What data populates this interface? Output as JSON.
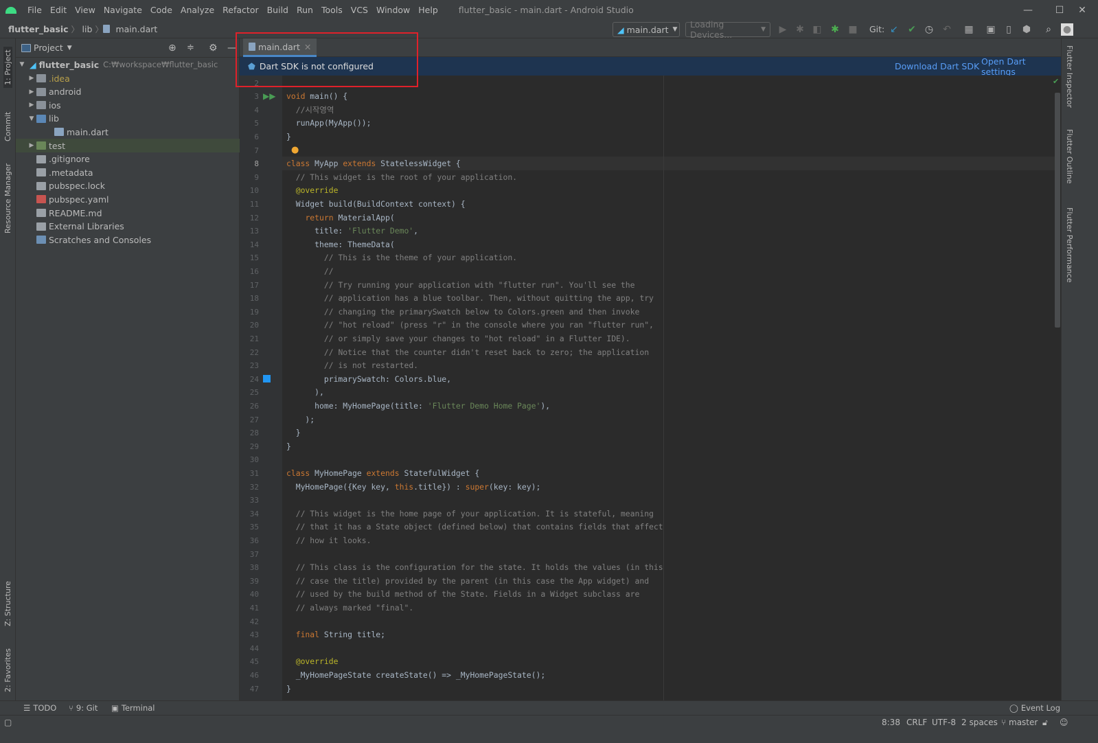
{
  "window": {
    "title": "flutter_basic - main.dart - Android Studio",
    "minimize": "—",
    "maximize": "☐",
    "close": "✕"
  },
  "menu": [
    "File",
    "Edit",
    "View",
    "Navigate",
    "Code",
    "Analyze",
    "Refactor",
    "Build",
    "Run",
    "Tools",
    "VCS",
    "Window",
    "Help"
  ],
  "breadcrumb": [
    "flutter_basic",
    "lib",
    "main.dart"
  ],
  "toolbar": {
    "run_config": "main.dart",
    "device": "Loading Devices...",
    "git_label": "Git:"
  },
  "project_panel": {
    "title": "Project",
    "root": {
      "name": "flutter_basic",
      "path": "C:₩workspace₩flutter_basic"
    },
    "items": [
      {
        "label": ".idea",
        "depth": 1,
        "arrow": "▶",
        "kind": "folder-idea"
      },
      {
        "label": "android",
        "depth": 1,
        "arrow": "▶",
        "kind": "folder"
      },
      {
        "label": "ios",
        "depth": 1,
        "arrow": "▶",
        "kind": "folder"
      },
      {
        "label": "lib",
        "depth": 1,
        "arrow": "▼",
        "kind": "folder-src"
      },
      {
        "label": "main.dart",
        "depth": 2,
        "arrow": "",
        "kind": "dart"
      },
      {
        "label": "test",
        "depth": 1,
        "arrow": "▶",
        "kind": "folder-test",
        "selected": true
      },
      {
        "label": ".gitignore",
        "depth": 1,
        "arrow": "",
        "kind": "file"
      },
      {
        "label": ".metadata",
        "depth": 1,
        "arrow": "",
        "kind": "file"
      },
      {
        "label": "pubspec.lock",
        "depth": 1,
        "arrow": "",
        "kind": "file"
      },
      {
        "label": "pubspec.yaml",
        "depth": 1,
        "arrow": "",
        "kind": "yaml"
      },
      {
        "label": "README.md",
        "depth": 1,
        "arrow": "",
        "kind": "file"
      },
      {
        "label": "External Libraries",
        "depth": 0,
        "arrow": "",
        "kind": "libs"
      },
      {
        "label": "Scratches and Consoles",
        "depth": 0,
        "arrow": "",
        "kind": "scratch"
      }
    ]
  },
  "left_stripe": [
    "1: Project",
    "Commit",
    "Resource Manager",
    "Z: Structure",
    "2: Favorites"
  ],
  "right_stripe": [
    "Flutter Inspector",
    "Flutter Outline",
    "Flutter Performance"
  ],
  "editor": {
    "tab": "main.dart",
    "banner": {
      "message": "Dart SDK is not configured",
      "download": "Download Dart SDK",
      "settings": "Open Dart settings"
    },
    "first_line": 2,
    "lines": [
      [],
      [
        [
          "k",
          "void"
        ],
        [
          "t",
          " main() {"
        ]
      ],
      [
        [
          "t",
          "  "
        ],
        [
          "c",
          "//시작영역"
        ]
      ],
      [
        [
          "t",
          "  runApp(MyApp());"
        ]
      ],
      [
        [
          "t",
          "}"
        ]
      ],
      [],
      [
        [
          "k",
          "class"
        ],
        [
          "t",
          " MyApp "
        ],
        [
          "k",
          "extends"
        ],
        [
          "t",
          " StatelessWidget {"
        ]
      ],
      [
        [
          "t",
          "  "
        ],
        [
          "c",
          "// This widget is the root of your application."
        ]
      ],
      [
        [
          "t",
          "  "
        ],
        [
          "a",
          "@override"
        ]
      ],
      [
        [
          "t",
          "  Widget build(BuildContext context) {"
        ]
      ],
      [
        [
          "t",
          "    "
        ],
        [
          "k",
          "return"
        ],
        [
          "t",
          " MaterialApp("
        ]
      ],
      [
        [
          "t",
          "      title: "
        ],
        [
          "s",
          "'Flutter Demo'"
        ],
        [
          "t",
          ","
        ]
      ],
      [
        [
          "t",
          "      theme: ThemeData("
        ]
      ],
      [
        [
          "t",
          "        "
        ],
        [
          "c",
          "// This is the theme of your application."
        ]
      ],
      [
        [
          "t",
          "        "
        ],
        [
          "c",
          "//"
        ]
      ],
      [
        [
          "t",
          "        "
        ],
        [
          "c",
          "// Try running your application with \"flutter run\". You'll see the"
        ]
      ],
      [
        [
          "t",
          "        "
        ],
        [
          "c",
          "// application has a blue toolbar. Then, without quitting the app, try"
        ]
      ],
      [
        [
          "t",
          "        "
        ],
        [
          "c",
          "// changing the primarySwatch below to Colors.green and then invoke"
        ]
      ],
      [
        [
          "t",
          "        "
        ],
        [
          "c",
          "// \"hot reload\" (press \"r\" in the console where you ran \"flutter run\","
        ]
      ],
      [
        [
          "t",
          "        "
        ],
        [
          "c",
          "// or simply save your changes to \"hot reload\" in a Flutter IDE)."
        ]
      ],
      [
        [
          "t",
          "        "
        ],
        [
          "c",
          "// Notice that the counter didn't reset back to zero; the application"
        ]
      ],
      [
        [
          "t",
          "        "
        ],
        [
          "c",
          "// is not restarted."
        ]
      ],
      [
        [
          "t",
          "        primarySwatch: Colors.blue,"
        ]
      ],
      [
        [
          "t",
          "      ),"
        ]
      ],
      [
        [
          "t",
          "      home: MyHomePage(title: "
        ],
        [
          "s",
          "'Flutter Demo Home Page'"
        ],
        [
          "t",
          "),"
        ]
      ],
      [
        [
          "t",
          "    );"
        ]
      ],
      [
        [
          "t",
          "  }"
        ]
      ],
      [
        [
          "t",
          "}"
        ]
      ],
      [],
      [
        [
          "k",
          "class"
        ],
        [
          "t",
          " MyHomePage "
        ],
        [
          "k",
          "extends"
        ],
        [
          "t",
          " StatefulWidget {"
        ]
      ],
      [
        [
          "t",
          "  MyHomePage({Key key, "
        ],
        [
          "k",
          "this"
        ],
        [
          "t",
          ".title}) : "
        ],
        [
          "k",
          "super"
        ],
        [
          "t",
          "(key: key);"
        ]
      ],
      [],
      [
        [
          "t",
          "  "
        ],
        [
          "c",
          "// This widget is the home page of your application. It is stateful, meaning"
        ]
      ],
      [
        [
          "t",
          "  "
        ],
        [
          "c",
          "// that it has a State object (defined below) that contains fields that affect"
        ]
      ],
      [
        [
          "t",
          "  "
        ],
        [
          "c",
          "// how it looks."
        ]
      ],
      [],
      [
        [
          "t",
          "  "
        ],
        [
          "c",
          "// This class is the configuration for the state. It holds the values (in this"
        ]
      ],
      [
        [
          "t",
          "  "
        ],
        [
          "c",
          "// case the title) provided by the parent (in this case the App widget) and"
        ]
      ],
      [
        [
          "t",
          "  "
        ],
        [
          "c",
          "// used by the build method of the State. Fields in a Widget subclass are"
        ]
      ],
      [
        [
          "t",
          "  "
        ],
        [
          "c",
          "// always marked \"final\"."
        ]
      ],
      [],
      [
        [
          "t",
          "  "
        ],
        [
          "k",
          "final"
        ],
        [
          "t",
          " String title;"
        ]
      ],
      [],
      [
        [
          "t",
          "  "
        ],
        [
          "a",
          "@override"
        ]
      ],
      [
        [
          "t",
          "  _MyHomePageState createState() => _MyHomePageState();"
        ]
      ],
      [
        [
          "t",
          "}"
        ]
      ]
    ]
  },
  "bottom_tools": {
    "todo": "TODO",
    "git": "9: Git",
    "terminal": "Terminal",
    "event_log": "Event Log"
  },
  "status": {
    "position": "8:38",
    "line_sep": "CRLF",
    "encoding": "UTF-8",
    "indent": "2 spaces",
    "branch": "master"
  },
  "colors": {
    "accent": "#4a88c7",
    "banner": "#1e3450",
    "link": "#589df6",
    "highlight": "#e0212a"
  }
}
